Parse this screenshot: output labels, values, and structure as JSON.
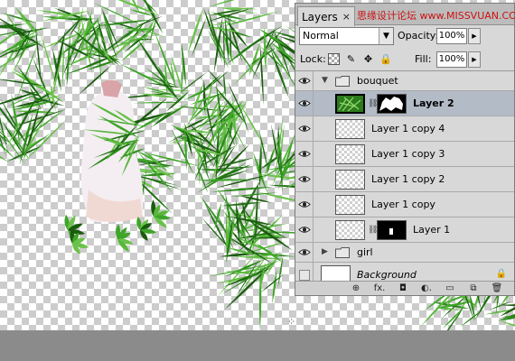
{
  "panel": {
    "tab_label": "Layers",
    "tab_close": "×",
    "watermark": "思缘设计论坛 www.MISSVUAN.COM",
    "blend_mode": "Normal",
    "opacity_label": "Opacity:",
    "opacity_value": "100%",
    "lock_label": "Lock:",
    "fill_label": "Fill:",
    "fill_value": "100%",
    "lock_icons": [
      "lock-transparent-icon",
      "lock-paint-icon",
      "lock-move-icon",
      "lock-all-icon"
    ]
  },
  "layers": [
    {
      "name": "bouquet",
      "type": "group",
      "expanded": true,
      "visible": true
    },
    {
      "name": "Layer 2",
      "type": "layer",
      "selected": true,
      "visible": true,
      "thumb": "green",
      "mask": "white-shape",
      "bold": true
    },
    {
      "name": "Layer 1 copy 4",
      "type": "layer",
      "visible": true,
      "thumb": "transparent"
    },
    {
      "name": "Layer 1 copy 3",
      "type": "layer",
      "visible": true,
      "thumb": "transparent"
    },
    {
      "name": "Layer 1 copy 2",
      "type": "layer",
      "visible": true,
      "thumb": "transparent"
    },
    {
      "name": "Layer 1 copy",
      "type": "layer",
      "visible": true,
      "thumb": "transparent"
    },
    {
      "name": "Layer 1",
      "type": "layer",
      "visible": true,
      "thumb": "transparent",
      "mask": "black-with-white"
    },
    {
      "name": "girl",
      "type": "group",
      "expanded": false,
      "visible": true
    },
    {
      "name": "Background",
      "type": "background",
      "visible": false,
      "thumb": "white",
      "italic": true,
      "locked": true
    }
  ],
  "footer_icons": [
    "link-layers-icon",
    "fx-icon",
    "add-mask-icon",
    "adjustment-layer-icon",
    "new-group-icon",
    "new-layer-icon",
    "trash-icon"
  ],
  "footer_glyphs": [
    "⊕",
    "fx.",
    "◘",
    "◐.",
    "▭",
    "⧉",
    "🗑"
  ],
  "colors": {
    "panel_bg": "#d8d8d8",
    "selected_row": "#b3bbc7",
    "leaf_green": "#2b7a1c"
  }
}
